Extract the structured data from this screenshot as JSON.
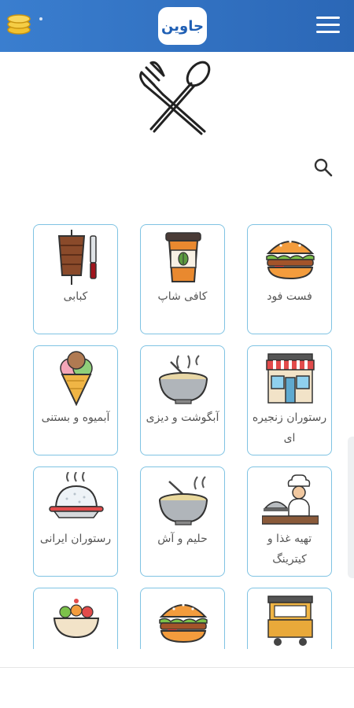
{
  "header": {
    "logo_text": "جاوین",
    "menu_icon": "hamburger-menu-icon",
    "coins_icon": "coins-icon"
  },
  "hero_icon": "fork-spoon-icon",
  "search_icon": "search-icon",
  "categories": [
    {
      "label": "فست فود",
      "icon": "burger-icon"
    },
    {
      "label": "کافی شاپ",
      "icon": "coffee-cup-icon"
    },
    {
      "label": "کبابی",
      "icon": "doner-kebab-icon"
    },
    {
      "label": "رستوران زنجیره ای",
      "icon": "storefront-icon"
    },
    {
      "label": "آبگوشت و دیزی",
      "icon": "stew-bowl-icon"
    },
    {
      "label": "آبمیوه و بستنی",
      "icon": "ice-cream-cone-icon"
    },
    {
      "label": "تهیه غذا و کیترینگ",
      "icon": "chef-catering-icon"
    },
    {
      "label": "حلیم و آش",
      "icon": "soup-bowl-icon"
    },
    {
      "label": "رستوران ایرانی",
      "icon": "rice-dish-icon"
    },
    {
      "label": "",
      "icon": "food-cart-icon"
    },
    {
      "label": "",
      "icon": "burger-icon"
    },
    {
      "label": "",
      "icon": "salad-bowl-icon"
    }
  ],
  "colors": {
    "header_start": "#3a7ecf",
    "header_end": "#2b67b6",
    "card_border": "#7fc3e3",
    "label_text": "#555555"
  }
}
